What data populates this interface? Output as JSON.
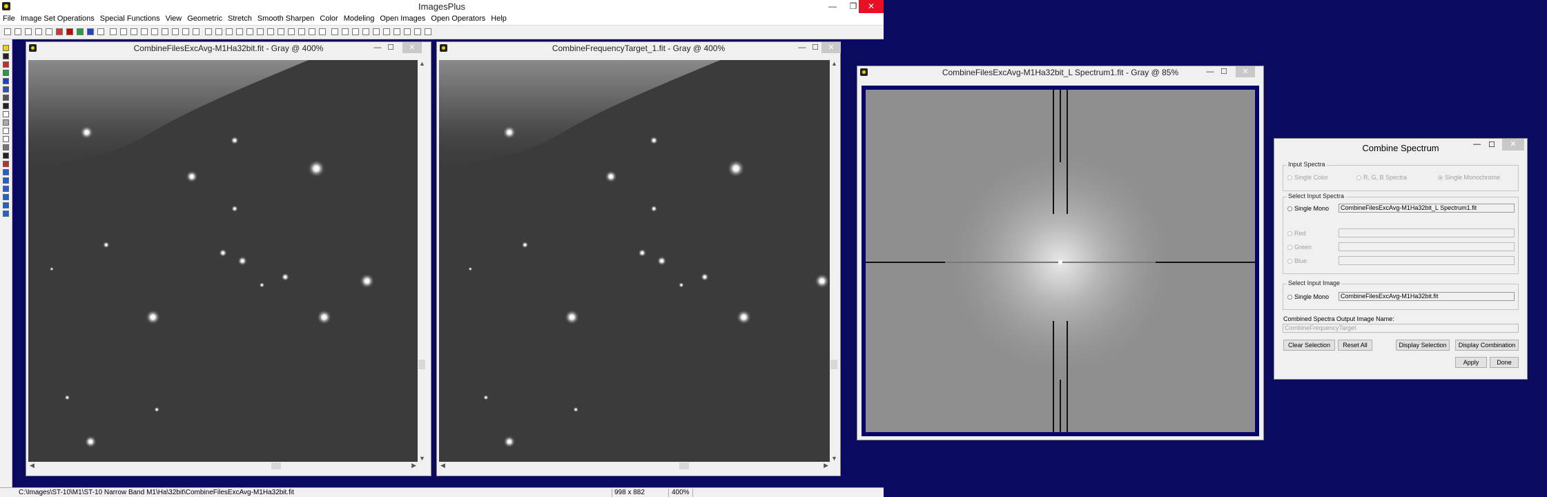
{
  "app": {
    "title": "ImagesPlus",
    "minimize": "—",
    "maximize": "❐",
    "close": "✕"
  },
  "menu": [
    "File",
    "Image Set Operations",
    "Special Functions",
    "View",
    "Geometric",
    "Stretch",
    "Smooth Sharpen",
    "Color",
    "Modeling",
    "Open Images",
    "Open Operators",
    "Help"
  ],
  "windows": {
    "left": {
      "title": "CombineFilesExcAvg-M1Ha32bit.fit - Gray @ 400%",
      "min": "—",
      "max": "☐",
      "close": "✕"
    },
    "middle": {
      "title": "CombineFrequencyTarget_1.fit - Gray @ 400%",
      "min": "—",
      "max": "☐",
      "close": "✕"
    },
    "spectrum": {
      "title": "CombineFilesExcAvg-M1Ha32bit_L Spectrum1.fit - Gray @ 85%",
      "min": "—",
      "max": "☐",
      "close": "✕"
    }
  },
  "dialog": {
    "title": "Combine Spectrum",
    "min": "—",
    "max": "☐",
    "close": "✕",
    "input_spectra": {
      "label": "Input Spectra",
      "options": [
        "Single Color",
        "R, G, B Spectra",
        "Single Monochrome"
      ]
    },
    "select_input_spectra": {
      "label": "Select Input Spectra",
      "single_mono_label": "Single Mono",
      "single_mono_value": "CombineFilesExcAvg-M1Ha32bit_L Spectrum1.fit",
      "red_label": "Red",
      "green_label": "Green",
      "blue_label": "Blue"
    },
    "select_input_image": {
      "label": "Select Input Image",
      "single_mono_label": "Single Mono",
      "single_mono_value": "CombineFilesExcAvg-M1Ha32bit.fit"
    },
    "output_name_label": "Combined Spectra Output Image Name:",
    "output_name_value": "CombineFrequencyTarget",
    "buttons": {
      "clear_selection": "Clear Selection",
      "reset_all": "Reset All",
      "display_selection": "Display Selection",
      "display_combination": "Display Combination",
      "apply": "Apply",
      "done": "Done"
    }
  },
  "status": {
    "path": "C:\\Images\\ST-10\\M1\\ST-10 Narrow Band M1\\Ha\\32bit\\CombineFilesExcAvg-M1Ha32bit.fit",
    "dimensions": "998 x 882",
    "zoom": "400%"
  },
  "colors": {
    "workspace": "#0a0a5e",
    "close_red": "#e81123",
    "spectrum_border": "#06066a"
  }
}
